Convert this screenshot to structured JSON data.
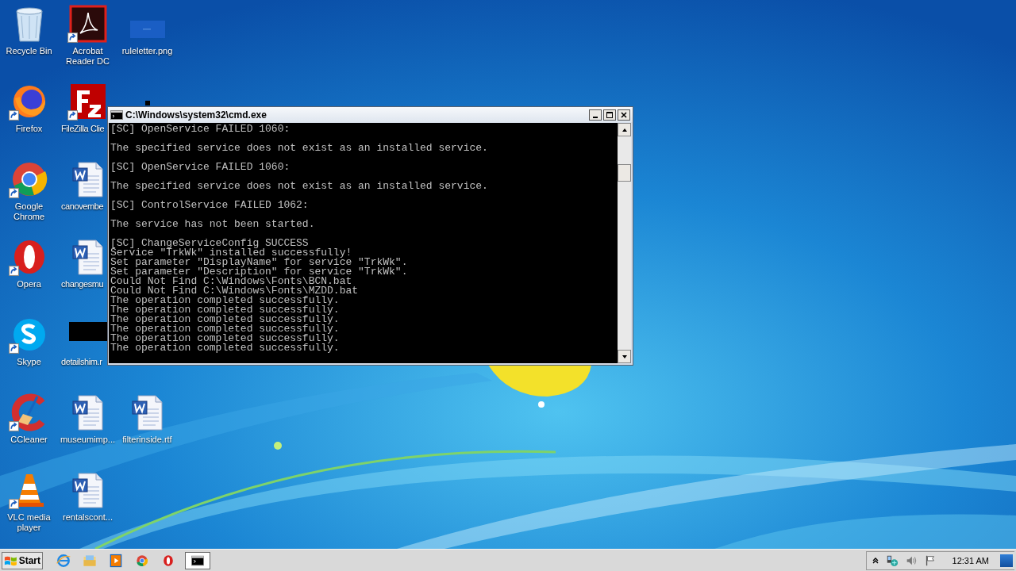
{
  "desktop": {
    "icons": [
      {
        "label": "Recycle Bin",
        "kind": "recycle",
        "shortcut": false
      },
      {
        "label": "Firefox",
        "kind": "firefox",
        "shortcut": true
      },
      {
        "label": "Google Chrome",
        "kind": "chrome",
        "shortcut": true
      },
      {
        "label": "Opera",
        "kind": "opera",
        "shortcut": true
      },
      {
        "label": "Skype",
        "kind": "skype",
        "shortcut": true
      },
      {
        "label": "CCleaner",
        "kind": "ccleaner",
        "shortcut": true
      },
      {
        "label": "VLC media player",
        "kind": "vlc",
        "shortcut": true
      },
      {
        "label": "Acrobat Reader DC",
        "kind": "acrobat",
        "shortcut": true
      },
      {
        "label": "FileZilla Clie",
        "kind": "filezilla",
        "shortcut": true
      },
      {
        "label": "canovembe",
        "kind": "word",
        "shortcut": false
      },
      {
        "label": "changesmu",
        "kind": "word",
        "shortcut": false
      },
      {
        "label": "detailshim.r",
        "kind": "dark-thumb",
        "shortcut": false
      },
      {
        "label": "museumimp...",
        "kind": "word",
        "shortcut": false
      },
      {
        "label": "rentalscont...",
        "kind": "word",
        "shortcut": false
      },
      {
        "label": "ruleletter.png",
        "kind": "image-thumb",
        "shortcut": false
      },
      {
        "kind": "dark-strip",
        "shortcut": false
      },
      {
        "label": "filterinside.rtf",
        "kind": "word",
        "shortcut": false
      }
    ]
  },
  "console_window": {
    "title": "C:\\Windows\\system32\\cmd.exe",
    "output_blocks": [
      [
        "[SC] OpenService FAILED 1060:"
      ],
      [
        "The specified service does not exist as an installed service."
      ],
      [
        "[SC] OpenService FAILED 1060:"
      ],
      [
        "The specified service does not exist as an installed service."
      ],
      [
        "[SC] ControlService FAILED 1062:"
      ],
      [
        "The service has not been started."
      ],
      [
        "[SC] ChangeServiceConfig SUCCESS",
        "Service \"TrkWk\" installed successfully!",
        "Set parameter \"DisplayName\" for service \"TrkWk\".",
        "Set parameter \"Description\" for service \"TrkWk\".",
        "Could Not Find C:\\Windows\\Fonts\\BCN.bat",
        "Could Not Find C:\\Windows\\Fonts\\MZDD.bat",
        "The operation completed successfully.",
        "The operation completed successfully.",
        "The operation completed successfully.",
        "The operation completed successfully.",
        "The operation completed successfully.",
        "The operation completed successfully."
      ]
    ]
  },
  "taskbar": {
    "start_label": "Start",
    "pinned": [
      {
        "kind": "ie"
      },
      {
        "kind": "folder"
      },
      {
        "kind": "media"
      },
      {
        "kind": "chrome"
      },
      {
        "kind": "opera"
      },
      {
        "kind": "console",
        "selected": true
      }
    ],
    "tray": {
      "clock": "12:31 AM"
    }
  }
}
